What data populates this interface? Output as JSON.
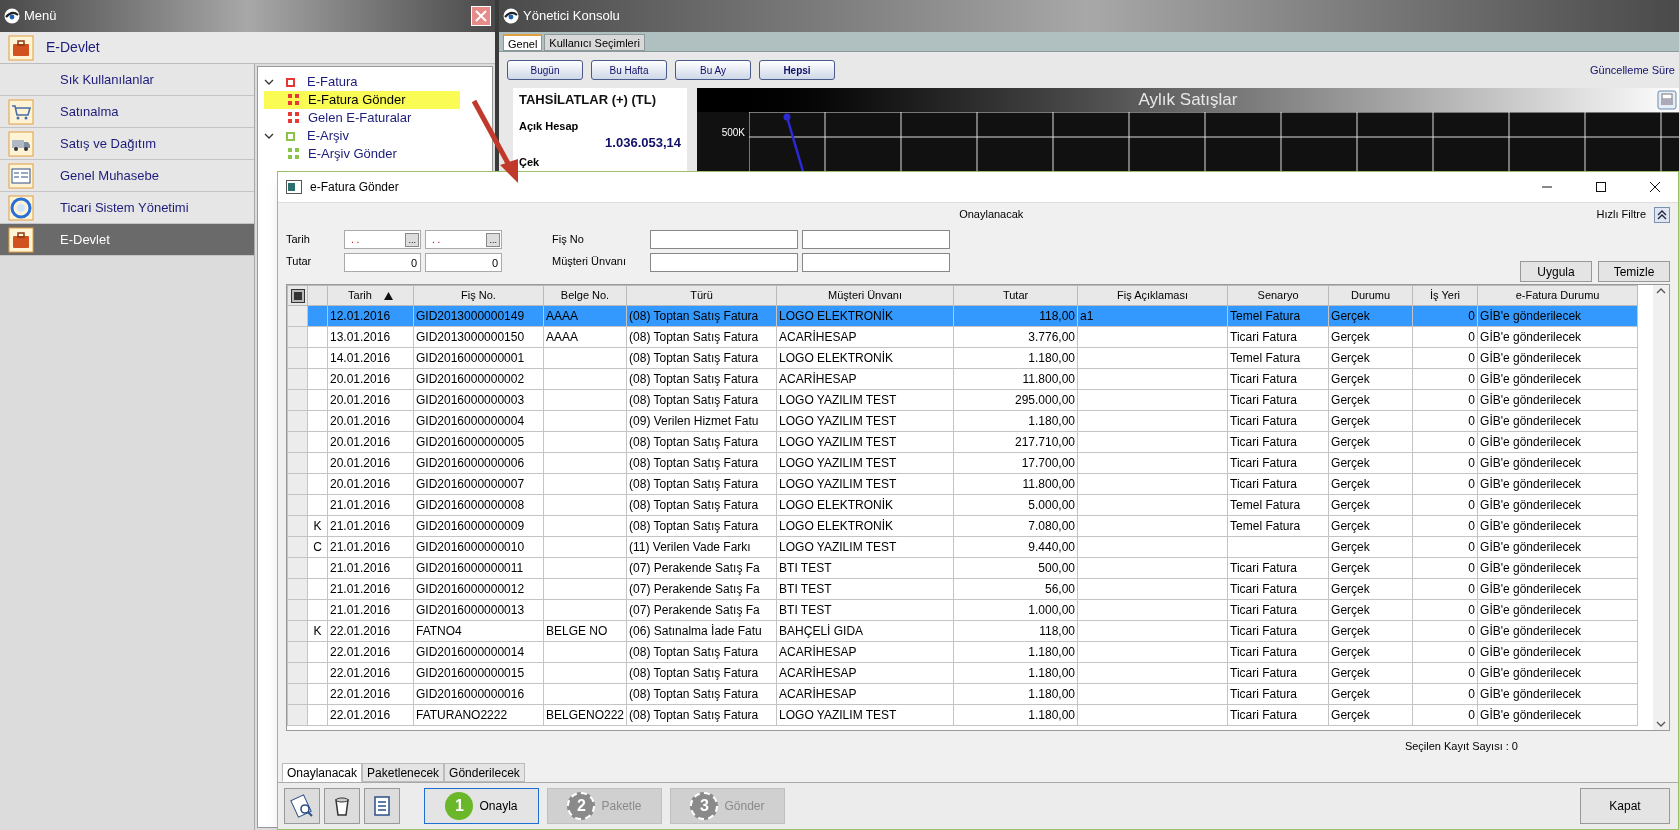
{
  "menu_window": {
    "title": "Menü",
    "header": "E-Devlet",
    "items": [
      {
        "label": "Sık Kullanılanlar",
        "selected": false
      },
      {
        "label": "Satınalma",
        "selected": false
      },
      {
        "label": "Satış ve Dağıtım",
        "selected": false
      },
      {
        "label": "Genel Muhasebe",
        "selected": false
      },
      {
        "label": "Ticari Sistem Yönetimi",
        "selected": false
      },
      {
        "label": "E-Devlet",
        "selected": true
      }
    ],
    "tree": [
      {
        "label": "E-Fatura",
        "expanded": true,
        "color": "#e53935",
        "children": [
          {
            "label": "E-Fatura Gönder",
            "selected": true
          },
          {
            "label": "Gelen E-Faturalar",
            "selected": false
          }
        ]
      },
      {
        "label": "E-Arşiv",
        "expanded": true,
        "color": "#8bc34a",
        "children": [
          {
            "label": "E-Arşiv Gönder",
            "selected": false
          }
        ]
      }
    ]
  },
  "console_window": {
    "title": "Yönetici Konsolu",
    "tabs": [
      {
        "label": "Genel",
        "selected": true
      },
      {
        "label": "Kullanıcı Seçimleri",
        "selected": false
      }
    ],
    "periods": [
      {
        "label": "Bugün",
        "selected": false
      },
      {
        "label": "Bu Hafta",
        "selected": false
      },
      {
        "label": "Bu Ay",
        "selected": false
      },
      {
        "label": "Hepsi",
        "selected": true
      }
    ],
    "update_label": "Güncelleme Süre",
    "collections": {
      "title": "TAHSİLATLAR (+) (TL)",
      "items": [
        {
          "label": "Açık Hesap",
          "value": "1.036.053,14"
        },
        {
          "label": "Çek"
        }
      ]
    },
    "chart": {
      "title": "Aylık Satışlar",
      "tick_label": "500K"
    }
  },
  "dialog": {
    "title": "e-Fatura Gönder",
    "subtitle": "Onaylanacak",
    "quick_filter": "Hızlı Filtre",
    "filters": {
      "date_label": "Tarih",
      "date_fields": [
        {
          "value": ". .",
          "button": "..."
        },
        {
          "value": ". .",
          "button": "..."
        }
      ],
      "amount_label": "Tutar",
      "amount_fields": [
        "0",
        "0"
      ],
      "receipt_label": "Fiş No",
      "customer_label": "Müşteri Ünvanı",
      "buttons": [
        "Uygula",
        "Temizle"
      ]
    },
    "table": {
      "select_all_checked": false,
      "columns": [
        {
          "label": "Tarih",
          "sorted": true
        },
        {
          "label": "Fiş No.",
          "sorted": false
        },
        {
          "label": "Belge No.",
          "sorted": false
        },
        {
          "label": "Türü",
          "sorted": false
        },
        {
          "label": "Müşteri Ünvanı",
          "sorted": false
        },
        {
          "label": "Tutar",
          "sorted": false
        },
        {
          "label": "Fiş Açıklaması",
          "sorted": false
        },
        {
          "label": "Senaryo",
          "sorted": false
        },
        {
          "label": "Durumu",
          "sorted": false
        },
        {
          "label": "İş Yeri",
          "sorted": false
        },
        {
          "label": "e-Fatura Durumu",
          "sorted": false
        }
      ],
      "rows": [
        {
          "selected": true,
          "date": "12.01.2016",
          "receipt_no": "GID2013000000149",
          "document_no": "AAAA",
          "type": "(08) Toptan Satış Fatura",
          "customer": "LOGO ELEKTRONİK",
          "amount": "118,00",
          "description": "a1",
          "scenario": "Temel Fatura",
          "status": "Gerçek",
          "workplace": "0",
          "efatura_status": "GİB'e gönderilecek"
        },
        {
          "selected": false,
          "date": "13.01.2016",
          "receipt_no": "GID2013000000150",
          "document_no": "AAAA",
          "type": "(08) Toptan Satış Fatura",
          "customer": "ACARİHESAP",
          "amount": "3.776,00",
          "scenario": "Ticari Fatura",
          "status": "Gerçek",
          "workplace": "0",
          "efatura_status": "GİB'e gönderilecek"
        },
        {
          "selected": false,
          "date": "14.01.2016",
          "receipt_no": "GID2016000000001",
          "type": "(08) Toptan Satış Fatura",
          "customer": "LOGO ELEKTRONİK",
          "amount": "1.180,00",
          "scenario": "Temel Fatura",
          "status": "Gerçek",
          "workplace": "0",
          "efatura_status": "GİB'e gönderilecek"
        },
        {
          "selected": false,
          "date": "20.01.2016",
          "receipt_no": "GID2016000000002",
          "type": "(08) Toptan Satış Fatura",
          "customer": "ACARİHESAP",
          "amount": "11.800,00",
          "scenario": "Ticari Fatura",
          "status": "Gerçek",
          "workplace": "0",
          "efatura_status": "GİB'e gönderilecek"
        },
        {
          "selected": false,
          "date": "20.01.2016",
          "receipt_no": "GID2016000000003",
          "type": "(08) Toptan Satış Fatura",
          "customer": "LOGO YAZILIM TEST",
          "amount": "295.000,00",
          "scenario": "Ticari Fatura",
          "status": "Gerçek",
          "workplace": "0",
          "efatura_status": "GİB'e gönderilecek"
        },
        {
          "selected": false,
          "date": "20.01.2016",
          "receipt_no": "GID2016000000004",
          "type": "(09) Verilen Hizmet Fatu",
          "customer": "LOGO YAZILIM TEST",
          "amount": "1.180,00",
          "scenario": "Ticari Fatura",
          "status": "Gerçek",
          "workplace": "0",
          "efatura_status": "GİB'e gönderilecek"
        },
        {
          "selected": false,
          "date": "20.01.2016",
          "receipt_no": "GID2016000000005",
          "type": "(08) Toptan Satış Fatura",
          "customer": "LOGO YAZILIM TEST",
          "amount": "217.710,00",
          "scenario": "Ticari Fatura",
          "status": "Gerçek",
          "workplace": "0",
          "efatura_status": "GİB'e gönderilecek"
        },
        {
          "selected": false,
          "date": "20.01.2016",
          "receipt_no": "GID2016000000006",
          "type": "(08) Toptan Satış Fatura",
          "customer": "LOGO YAZILIM TEST",
          "amount": "17.700,00",
          "scenario": "Ticari Fatura",
          "status": "Gerçek",
          "workplace": "0",
          "efatura_status": "GİB'e gönderilecek"
        },
        {
          "selected": false,
          "date": "20.01.2016",
          "receipt_no": "GID2016000000007",
          "type": "(08) Toptan Satış Fatura",
          "customer": "LOGO YAZILIM TEST",
          "amount": "11.800,00",
          "scenario": "Ticari Fatura",
          "status": "Gerçek",
          "workplace": "0",
          "efatura_status": "GİB'e gönderilecek"
        },
        {
          "selected": false,
          "date": "21.01.2016",
          "receipt_no": "GID2016000000008",
          "type": "(08) Toptan Satış Fatura",
          "customer": "LOGO ELEKTRONİK",
          "amount": "5.000,00",
          "scenario": "Temel Fatura",
          "status": "Gerçek",
          "workplace": "0",
          "efatura_status": "GİB'e gönderilecek"
        },
        {
          "selected": false,
          "mark": "K",
          "date": "21.01.2016",
          "receipt_no": "GID2016000000009",
          "type": "(08) Toptan Satış Fatura",
          "customer": "LOGO ELEKTRONİK",
          "amount": "7.080,00",
          "scenario": "Temel Fatura",
          "status": "Gerçek",
          "workplace": "0",
          "efatura_status": "GİB'e gönderilecek"
        },
        {
          "selected": false,
          "mark": "C",
          "date": "21.01.2016",
          "receipt_no": "GID2016000000010",
          "type": "(11) Verilen Vade Farkı",
          "customer": "LOGO YAZILIM TEST",
          "amount": "9.440,00",
          "status": "Gerçek",
          "workplace": "0",
          "efatura_status": "GİB'e gönderilecek"
        },
        {
          "selected": false,
          "date": "21.01.2016",
          "receipt_no": "GID2016000000011",
          "type": "(07) Perakende Satış Fa",
          "customer": "BTI TEST",
          "amount": "500,00",
          "scenario": "Ticari Fatura",
          "status": "Gerçek",
          "workplace": "0",
          "efatura_status": "GİB'e gönderilecek"
        },
        {
          "selected": false,
          "date": "21.01.2016",
          "receipt_no": "GID2016000000012",
          "type": "(07) Perakende Satış Fa",
          "customer": "BTI TEST",
          "amount": "56,00",
          "scenario": "Ticari Fatura",
          "status": "Gerçek",
          "workplace": "0",
          "efatura_status": "GİB'e gönderilecek"
        },
        {
          "selected": false,
          "date": "21.01.2016",
          "receipt_no": "GID2016000000013",
          "type": "(07) Perakende Satış Fa",
          "customer": "BTI TEST",
          "amount": "1.000,00",
          "scenario": "Ticari Fatura",
          "status": "Gerçek",
          "workplace": "0",
          "efatura_status": "GİB'e gönderilecek"
        },
        {
          "selected": false,
          "mark": "K",
          "date": "22.01.2016",
          "receipt_no": "FATNO4",
          "document_no": "BELGE NO",
          "type": "(06) Satınalma İade Fatu",
          "customer": "BAHÇELİ GIDA",
          "amount": "118,00",
          "scenario": "Ticari Fatura",
          "status": "Gerçek",
          "workplace": "0",
          "efatura_status": "GİB'e gönderilecek"
        },
        {
          "selected": false,
          "date": "22.01.2016",
          "receipt_no": "GID2016000000014",
          "type": "(08) Toptan Satış Fatura",
          "customer": "ACARİHESAP",
          "amount": "1.180,00",
          "scenario": "Ticari Fatura",
          "status": "Gerçek",
          "workplace": "0",
          "efatura_status": "GİB'e gönderilecek"
        },
        {
          "selected": false,
          "date": "22.01.2016",
          "receipt_no": "GID2016000000015",
          "type": "(08) Toptan Satış Fatura",
          "customer": "ACARİHESAP",
          "amount": "1.180,00",
          "scenario": "Ticari Fatura",
          "status": "Gerçek",
          "workplace": "0",
          "efatura_status": "GİB'e gönderilecek"
        },
        {
          "selected": false,
          "date": "22.01.2016",
          "receipt_no": "GID2016000000016",
          "type": "(08) Toptan Satış Fatura",
          "customer": "ACARİHESAP",
          "amount": "1.180,00",
          "scenario": "Ticari Fatura",
          "status": "Gerçek",
          "workplace": "0",
          "efatura_status": "GİB'e gönderilecek"
        },
        {
          "selected": false,
          "date": "22.01.2016",
          "receipt_no": "FATURANO2222",
          "document_no": "BELGENO222",
          "type": "(08) Toptan Satış Fatura",
          "customer": "LOGO YAZILIM TEST",
          "amount": "1.180,00",
          "scenario": "Ticari Fatura",
          "status": "Gerçek",
          "workplace": "0",
          "efatura_status": "GİB'e gönderilecek"
        }
      ]
    },
    "status": "Seçilen Kayıt Sayısı : 0",
    "tabs": [
      {
        "label": "Onaylanacak",
        "selected": true
      },
      {
        "label": "Paketlenecek",
        "selected": false
      },
      {
        "label": "Gönderilecek",
        "selected": false
      }
    ],
    "steps": [
      {
        "number": "1",
        "label": "Onayla",
        "disabled": false
      },
      {
        "number": "2",
        "label": "Paketle",
        "disabled": true
      },
      {
        "number": "3",
        "label": "Gönder",
        "disabled": true
      }
    ],
    "close_button": "Kapat"
  }
}
